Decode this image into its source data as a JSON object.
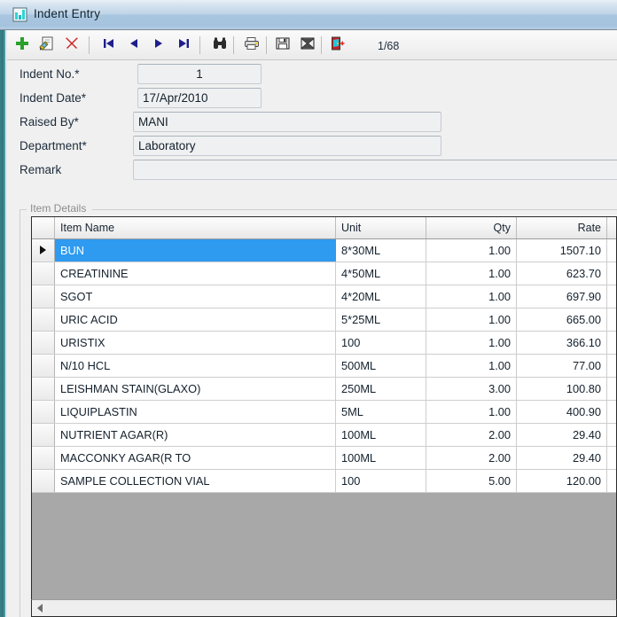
{
  "window": {
    "title": "Indent Entry",
    "icon": "chart-bars-icon",
    "accent_teal": "#2d777f",
    "titlebar_blue": "#a9c6e0"
  },
  "toolbar": {
    "buttons": [
      {
        "name": "add-record-button",
        "icon": "plus-icon",
        "label": "Add"
      },
      {
        "name": "edit-record-button",
        "icon": "edit-document-icon",
        "label": "Edit"
      },
      {
        "name": "delete-record-button",
        "icon": "delete-x-icon",
        "label": "Delete"
      },
      {
        "name": "first-record-button",
        "icon": "first-arrow-icon",
        "label": "First"
      },
      {
        "name": "prev-record-button",
        "icon": "prev-arrow-icon",
        "label": "Previous"
      },
      {
        "name": "next-record-button",
        "icon": "next-arrow-icon",
        "label": "Next"
      },
      {
        "name": "last-record-button",
        "icon": "last-arrow-icon",
        "label": "Last"
      },
      {
        "name": "find-button",
        "icon": "binoculars-icon",
        "label": "Find"
      },
      {
        "name": "print-button",
        "icon": "printer-icon",
        "label": "Print"
      },
      {
        "name": "save-button",
        "icon": "floppy-disk-icon",
        "label": "Save"
      },
      {
        "name": "cancel-button",
        "icon": "cancel-icon",
        "label": "Cancel"
      },
      {
        "name": "exit-button",
        "icon": "exit-door-icon",
        "label": "Exit"
      }
    ],
    "record_counter": "1/68"
  },
  "form": {
    "fields": [
      {
        "label": "Indent No.*",
        "value": "1",
        "placeholder": ""
      },
      {
        "label": "Indent Date*",
        "value": "17/Apr/2010",
        "placeholder": ""
      },
      {
        "label": "Raised By*",
        "value": "MANI",
        "placeholder": ""
      },
      {
        "label": "Department*",
        "value": "Laboratory",
        "placeholder": ""
      },
      {
        "label": "Remark",
        "value": "",
        "placeholder": ""
      }
    ]
  },
  "item_details": {
    "legend": "Item Details",
    "columns": [
      "Item Name",
      "Unit",
      "Qty",
      "Rate"
    ],
    "selected_row_index": 0,
    "selected_row_color": "#2e9af0",
    "rows": [
      {
        "item_name": "BUN",
        "unit": "8*30ML",
        "qty": "1.00",
        "rate": "1507.10"
      },
      {
        "item_name": "CREATININE",
        "unit": "4*50ML",
        "qty": "1.00",
        "rate": "623.70"
      },
      {
        "item_name": "SGOT",
        "unit": "4*20ML",
        "qty": "1.00",
        "rate": "697.90"
      },
      {
        "item_name": "URIC ACID",
        "unit": "5*25ML",
        "qty": "1.00",
        "rate": "665.00"
      },
      {
        "item_name": "URISTIX",
        "unit": "100",
        "qty": "1.00",
        "rate": "366.10"
      },
      {
        "item_name": "N/10 HCL",
        "unit": "500ML",
        "qty": "1.00",
        "rate": "77.00"
      },
      {
        "item_name": "LEISHMAN STAIN(GLAXO)",
        "unit": "250ML",
        "qty": "3.00",
        "rate": "100.80"
      },
      {
        "item_name": "LIQUIPLASTIN",
        "unit": "5ML",
        "qty": "1.00",
        "rate": "400.90"
      },
      {
        "item_name": "NUTRIENT AGAR(R)",
        "unit": "100ML",
        "qty": "2.00",
        "rate": "29.40"
      },
      {
        "item_name": "MACCONKY AGAR(R TO",
        "unit": "100ML",
        "qty": "2.00",
        "rate": "29.40"
      },
      {
        "item_name": "SAMPLE COLLECTION VIAL",
        "unit": "100",
        "qty": "5.00",
        "rate": "120.00"
      }
    ]
  },
  "scrollbar": {
    "left_arrow": "scroll-left-arrow-icon"
  }
}
